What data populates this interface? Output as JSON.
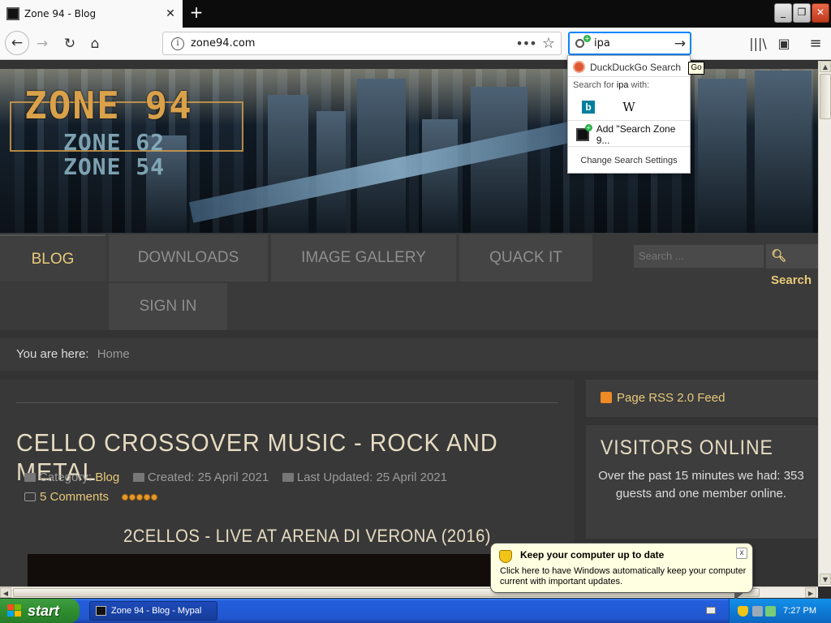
{
  "browser": {
    "tab_title": "Zone 94 - Blog",
    "tab_close": "✕",
    "new_tab": "+",
    "url": "zone94.com",
    "search_query": "ipa",
    "win_min": "_",
    "win_max": "❐",
    "win_close": "✕"
  },
  "icons": {
    "back": "back-arrow-icon",
    "forward": "forward-arrow-icon",
    "reload": "reload-icon",
    "home": "home-icon",
    "library": "library-icon",
    "sidebar": "sidebar-icon",
    "menu": "hamburger-menu-icon"
  },
  "search_dropdown": {
    "engine": "DuckDuckGo Search",
    "search_for_prefix": "Search for ",
    "search_for_term": "ipa",
    "search_for_suffix": " with:",
    "bing_label": "b",
    "wiki_label": "W",
    "add_engine": "Add \"Search Zone 9...",
    "change_settings": "Change Search Settings",
    "go_tooltip": "Go"
  },
  "site": {
    "logo_main": "ZONE 94",
    "logo_sub1": "ZONE 62",
    "logo_sub2": "ZONE 54",
    "menu": {
      "blog": "BLOG",
      "downloads": "DOWNLOADS",
      "gallery": "IMAGE GALLERY",
      "quack": "QUACK IT",
      "signin": "SIGN IN"
    },
    "search_placeholder": "Search ...",
    "search_button": "Search",
    "breadcrumb_label": "You are here:",
    "breadcrumb_home": "Home"
  },
  "article": {
    "title": "CELLO CROSSOVER MUSIC - ROCK AND METAL",
    "category_label": "Category:",
    "category_value": "Blog",
    "created": "Created: 25 April 2021",
    "updated": "Last Updated: 25 April 2021",
    "comments": "5 Comments",
    "rating": 5,
    "video_title": "2CELLOS - LIVE AT ARENA DI VERONA (2016)"
  },
  "sidebar": {
    "rss": "Page RSS 2.0 Feed",
    "visitors_title": "VISITORS ONLINE",
    "visitors_text": "Over the past 15 minutes we had: 353 guests and one member online."
  },
  "balloon": {
    "title": "Keep your computer up to date",
    "text": "Click here to have Windows automatically keep your computer current with important updates.",
    "close": "x"
  },
  "taskbar": {
    "start": "start",
    "task": "Zone 94 - Blog - Mypal",
    "clock": "7:27 PM"
  },
  "colors": {
    "accent_gold": "#e8c97a",
    "firefox_focus": "#0a84ff",
    "xp_start_green": "#2d8a2e",
    "xp_taskbar_blue": "#245edb"
  }
}
